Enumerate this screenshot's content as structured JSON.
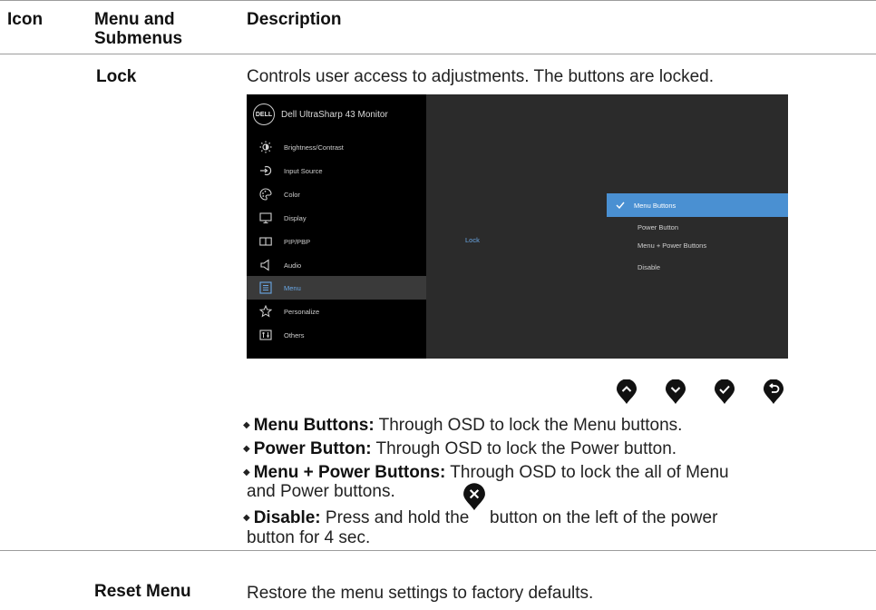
{
  "header": {
    "icon": "Icon",
    "menu_line1": "Menu and",
    "menu_line2": "Submenus",
    "description": "Description"
  },
  "lock_row": {
    "label": "Lock",
    "description": "Controls user access to adjustments. The buttons are locked."
  },
  "osd": {
    "logo_text": "DELL",
    "title": "Dell UltraSharp 43 Monitor",
    "menu": [
      {
        "label": "Brightness/Contrast",
        "icon": "brightness-icon"
      },
      {
        "label": "Input Source",
        "icon": "input-source-icon"
      },
      {
        "label": "Color",
        "icon": "color-palette-icon"
      },
      {
        "label": "Display",
        "icon": "display-icon"
      },
      {
        "label": "PIP/PBP",
        "icon": "pip-pbp-icon"
      },
      {
        "label": "Audio",
        "icon": "speaker-icon"
      },
      {
        "label": "Menu",
        "icon": "menu-icon",
        "selected": true
      },
      {
        "label": "Personalize",
        "icon": "star-icon"
      },
      {
        "label": "Others",
        "icon": "others-icon"
      }
    ],
    "submenu_label": "Lock",
    "options": [
      {
        "label": "Menu Buttons",
        "selected": true
      },
      {
        "label": "Power Button"
      },
      {
        "label": "Menu + Power Buttons"
      },
      {
        "label": "Disable"
      }
    ],
    "colors": {
      "background": "#2b2b2b",
      "sidebar": "#000000",
      "accent": "#4a90d2",
      "accent_text": "#6aa8e6"
    }
  },
  "buttons": [
    "up-button-icon",
    "down-button-icon",
    "check-button-icon",
    "back-button-icon"
  ],
  "bullets": [
    {
      "term": "Menu Buttons:",
      "text": "Through OSD to lock the Menu buttons."
    },
    {
      "term": "Power Button:",
      "text": "Through OSD to lock the Power button."
    },
    {
      "term": "Menu + Power Buttons:",
      "text": "Through OSD to lock the all of Menu",
      "text2": "and Power buttons."
    },
    {
      "term": "Disable:",
      "text_a": "Press and hold the",
      "text_b": "button on the left of the power",
      "text2": "button for 4 sec."
    }
  ],
  "reset_row": {
    "label": "Reset Menu",
    "description": "Restore the menu settings to factory defaults."
  }
}
